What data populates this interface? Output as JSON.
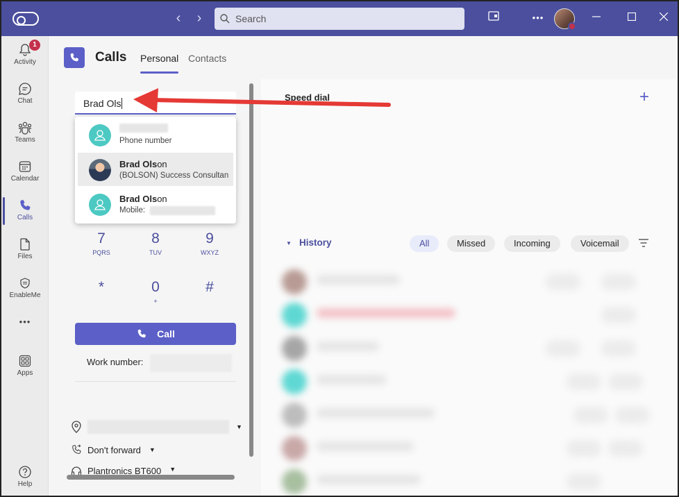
{
  "titlebar": {
    "search_placeholder": "Search",
    "more_label": "•••"
  },
  "rail": {
    "activity_label": "Activity",
    "activity_badge": "1",
    "chat_label": "Chat",
    "teams_label": "Teams",
    "calendar_label": "Calendar",
    "calls_label": "Calls",
    "files_label": "Files",
    "enableme_label": "EnableMe",
    "more_label": "•••",
    "apps_label": "Apps",
    "help_label": "Help"
  },
  "header": {
    "title": "Calls",
    "tabs": [
      {
        "label": "Personal",
        "active": true
      },
      {
        "label": "Contacts",
        "active": false
      }
    ]
  },
  "dialer": {
    "input_value": "Brad Ols",
    "suggestions": [
      {
        "name": "",
        "sub": "Phone number"
      },
      {
        "name_bold": "Brad Ols",
        "name_rest": "on",
        "sub": "(BOLSON) Success Consultan"
      },
      {
        "name_bold": "Brad Ols",
        "name_rest": "on",
        "sub": "Mobile:"
      }
    ],
    "keys": [
      {
        "digit": "7",
        "letters": "PQRS"
      },
      {
        "digit": "8",
        "letters": "TUV"
      },
      {
        "digit": "9",
        "letters": "WXYZ"
      },
      {
        "digit": "*",
        "letters": ""
      },
      {
        "digit": "0",
        "letters": "+"
      },
      {
        "digit": "#",
        "letters": ""
      }
    ],
    "call_label": "Call",
    "work_number_label": "Work number:",
    "forward_label": "Don't forward",
    "device_label": "Plantronics BT600"
  },
  "speed_dial": {
    "title": "Speed dial"
  },
  "history": {
    "title": "History",
    "filters": [
      {
        "label": "All",
        "active": true
      },
      {
        "label": "Missed",
        "active": false
      },
      {
        "label": "Incoming",
        "active": false
      },
      {
        "label": "Voicemail",
        "active": false
      }
    ]
  },
  "colors": {
    "titlebar": "#4b4f9e",
    "accent": "#5b5fc7",
    "annotation_arrow": "#e53935"
  }
}
